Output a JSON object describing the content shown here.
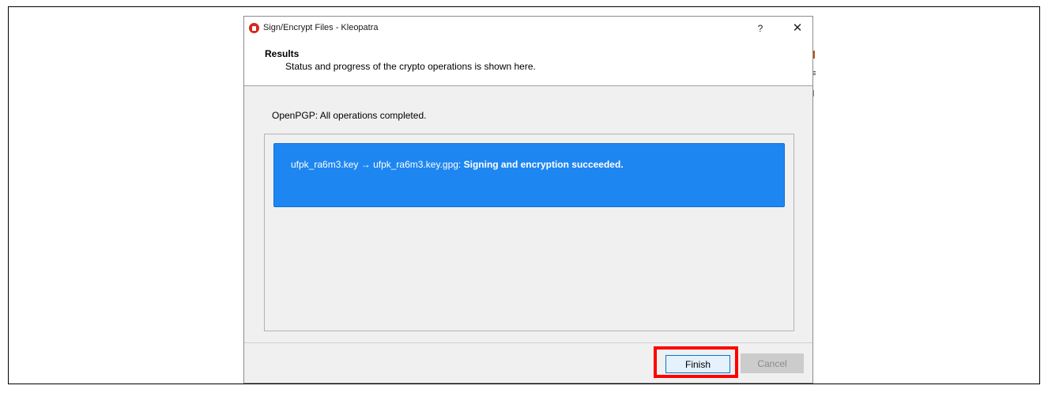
{
  "window": {
    "title": "Sign/Encrypt Files - Kleopatra",
    "help_label": "?",
    "close_label": "✕",
    "app_icon": "kleopatra-icon"
  },
  "header": {
    "title": "Results",
    "subtitle": "Status and progress of the crypto operations is shown here."
  },
  "status": {
    "text": "OpenPGP: All operations completed."
  },
  "results": [
    {
      "source": "ufpk_ra6m3.key",
      "arrow": "→",
      "target": "ufpk_ra6m3.key.gpg:",
      "message": "Signing and encryption succeeded.",
      "color": "#1e86f1"
    }
  ],
  "buttons": {
    "finish": "Finish",
    "cancel": "Cancel"
  },
  "colors": {
    "highlight": "#ff0000",
    "result_background": "#1e86f1",
    "dialog_background": "#f0f0f0"
  }
}
